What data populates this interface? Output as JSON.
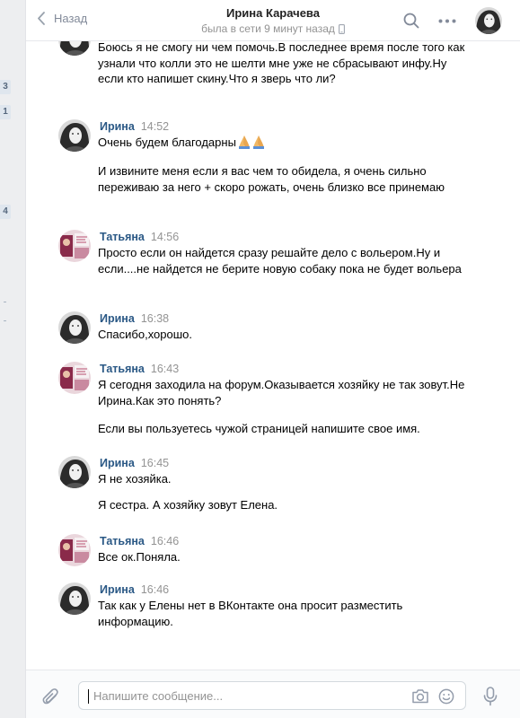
{
  "sidebar_badges": [
    "3",
    "1",
    "4"
  ],
  "header": {
    "back_label": "Назад",
    "peer_name": "Ирина Карачева",
    "peer_status": "была в сети 9 минут назад"
  },
  "messages": [
    {
      "author": "",
      "time": "",
      "avatar": "irina",
      "paragraphs": [
        "Боюсь я не смогу ни чем помочь.В последнее время после того как узнали что колли это не шелти мне уже не сбрасывают инфу.Ну если кто напишет скину.Что я зверь что ли?"
      ]
    },
    {
      "author": "Ирина",
      "time": "14:52",
      "avatar": "irina",
      "paragraphs": [
        "Очень будем благодарны",
        "И извините меня если я вас чем то обидела, я очень сильно переживаю за него + скоро рожать, очень близко все принемаю"
      ]
    },
    {
      "author": "Татьяна",
      "time": "14:56",
      "avatar": "tatiana",
      "paragraphs": [
        "Просто если он найдется сразу решайте дело с вольером.Ну и если....не найдется не берите новую собаку пока не будет вольера"
      ]
    },
    {
      "author": "Ирина",
      "time": "16:38",
      "avatar": "irina",
      "paragraphs": [
        "Спасибо,хорошо."
      ]
    },
    {
      "author": "Татьяна",
      "time": "16:43",
      "avatar": "tatiana",
      "paragraphs": [
        "Я сегодня заходила на форум.Оказывается хозяйку не так зовут.Не Ирина.Как это понять?",
        "Если вы пользуетесь чужой страницей напишите свое имя."
      ]
    },
    {
      "author": "Ирина",
      "time": "16:45",
      "avatar": "irina",
      "paragraphs": [
        "Я не хозяйка.",
        "Я сестра. А хозяйку зовут Елена."
      ]
    },
    {
      "author": "Татьяна",
      "time": "16:46",
      "avatar": "tatiana",
      "paragraphs": [
        "Все ок.Поняла."
      ]
    },
    {
      "author": "Ирина",
      "time": "16:46",
      "avatar": "irina",
      "paragraphs": [
        "Так как у Елены нет в ВКонтакте она просит разместить информацию."
      ]
    }
  ],
  "composer": {
    "placeholder": "Напишите сообщение..."
  },
  "icons": {
    "back": "chevron-left-icon",
    "search": "search-icon",
    "more": "more-dots-icon",
    "phone": "mobile-phone-icon",
    "praying_hands": "praying-hands-emoji",
    "attach": "paperclip-icon",
    "camera": "camera-icon",
    "emoji": "smile-icon",
    "mic": "microphone-icon"
  },
  "colors": {
    "author_name": "#2a5885",
    "timestamp": "#939393",
    "page_background": "#edeef0"
  }
}
